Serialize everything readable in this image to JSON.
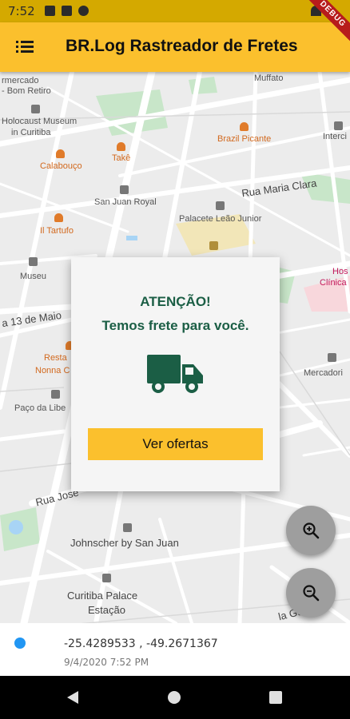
{
  "status_bar": {
    "time": "7:52",
    "icons": [
      "message-icon",
      "sd-card-icon",
      "data-saver-icon"
    ],
    "right_icons": [
      "wifi-icon",
      "signal-icon",
      "battery-icon"
    ],
    "debug_banner": "DEBUG"
  },
  "app_bar": {
    "title": "BR.Log Rastreador de Fretes",
    "menu_icon": "menu-icon"
  },
  "map": {
    "labels": [
      "rmercado",
      "- Bom Retiro",
      "Holocaust Museum",
      "in Curitiba",
      "Calabouço",
      "Takê",
      "San Juan Royal",
      "Il Tartufo",
      "Museu",
      "a 13 de Maio",
      "Resta",
      "Nonna C",
      "Paço da Libe",
      "Rua José",
      "Johnscher by San Juan",
      "Curitiba Palace",
      "Estação",
      "Brazil Picante",
      "Interci",
      "Rua Maria Clara",
      "Palacete Leão Junior",
      "Hos",
      "Clínica",
      "Mercadori",
      "Muffato",
      "la Gue"
    ]
  },
  "dialog": {
    "line1": "ATENÇÃO!",
    "line2": "Temos frete para você.",
    "icon": "truck-icon",
    "button_label": "Ver ofertas",
    "accent_color": "#1b5e45",
    "button_color": "#fbc02d"
  },
  "fabs": {
    "zoom_in_icon": "zoom-in-icon",
    "zoom_out_icon": "zoom-out-icon"
  },
  "location": {
    "coordinates": "-25.4289533 , -49.2671367",
    "timestamp": "9/4/2020 7:52 PM"
  },
  "nav_bar": {
    "icons": [
      "back-icon",
      "home-icon",
      "recents-icon"
    ]
  }
}
